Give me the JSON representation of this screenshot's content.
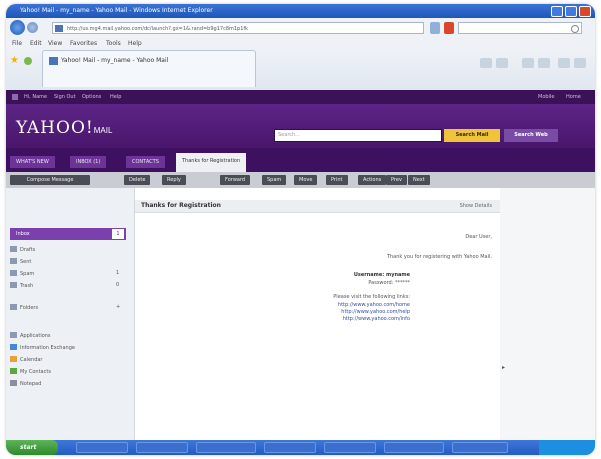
{
  "browser": {
    "title": "Yahoo! Mail - my_name - Yahoo Mail - Windows Internet Explorer",
    "address": "http://us.mg4.mail.yahoo.com/dc/launch?.gx=1&.rand=b9g17c8m1p1fk",
    "menu": [
      "File",
      "Edit",
      "View",
      "Favorites",
      "Tools",
      "Help"
    ],
    "tab_label": "Yahoo! Mail - my_name - Yahoo Mail"
  },
  "yahoo": {
    "top_links": [
      "Hi, Name",
      "Sign Out",
      "Options",
      "Help"
    ],
    "top_right": [
      "Mobile",
      "Home"
    ],
    "logo_main": "YAHOO!",
    "logo_sub": "MAIL",
    "search_placeholder": "Search...",
    "search_mail_btn": "Search Mail",
    "search_web_btn": "Search Web",
    "tabs": [
      "WHAT'S NEW",
      "INBOX (1)",
      "CONTACTS",
      "Thanks for Registration"
    ]
  },
  "toolbar": {
    "compose": "Compose Message",
    "buttons": [
      "Delete",
      "Reply",
      "Forward",
      "Spam",
      "Move",
      "Print",
      "Actions",
      "Prev",
      "Next"
    ]
  },
  "sidebar": {
    "inbox_label": "Inbox",
    "inbox_count": "1",
    "items": [
      {
        "label": "Drafts",
        "count": ""
      },
      {
        "label": "Sent",
        "count": ""
      },
      {
        "label": "Spam",
        "count": "1"
      },
      {
        "label": "Trash",
        "count": "0"
      },
      {
        "label": "Folders",
        "count": "+"
      }
    ],
    "apps_label": "Applications",
    "apps": [
      "Information Exchange",
      "Calendar",
      "My Contacts",
      "Notepad"
    ]
  },
  "message": {
    "subject": "Thanks for Registration",
    "meta": "Show Details",
    "lines": [
      "Dear User,",
      "Thank you for registering with Yahoo Mail.",
      "Username: myname",
      "Password: ******",
      "Please visit the following links:",
      "http://www.yahoo.com/home",
      "http://www.yahoo.com/help",
      "http://www.yahoo.com/info"
    ]
  },
  "taskbar": {
    "start": "start"
  }
}
